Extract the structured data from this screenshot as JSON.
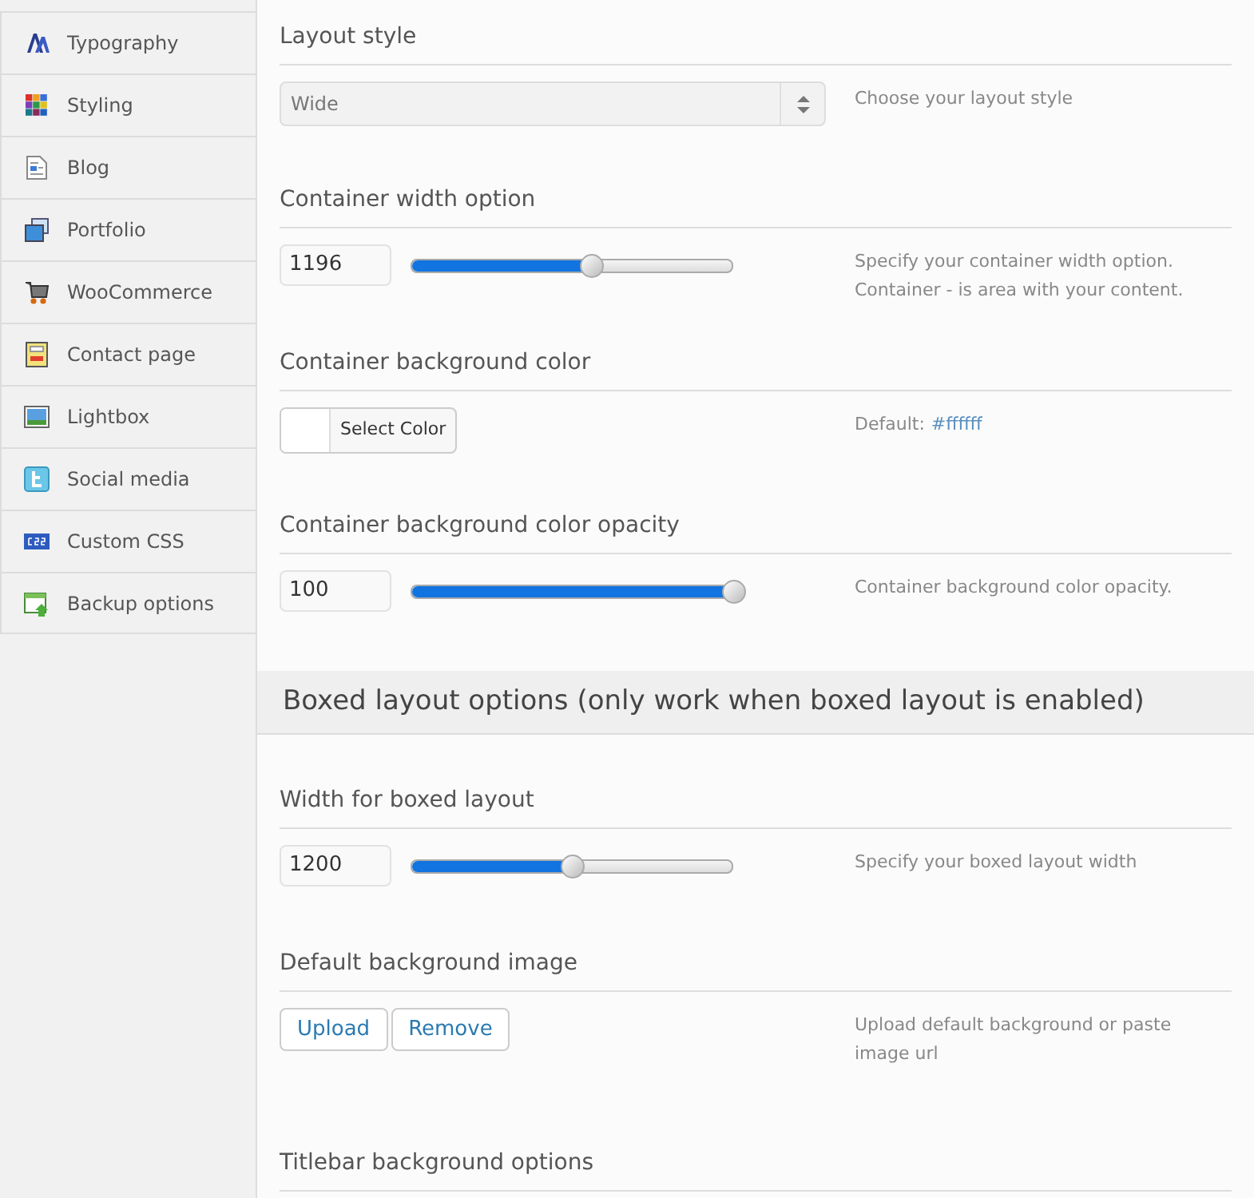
{
  "sidebar": {
    "items": [
      {
        "label": "Typography"
      },
      {
        "label": "Styling"
      },
      {
        "label": "Blog"
      },
      {
        "label": "Portfolio"
      },
      {
        "label": "WooCommerce"
      },
      {
        "label": "Contact page"
      },
      {
        "label": "Lightbox"
      },
      {
        "label": "Social media"
      },
      {
        "label": "Custom CSS"
      },
      {
        "label": "Backup options"
      }
    ]
  },
  "sections": [
    {
      "kind": "select",
      "heading": "Layout style",
      "value": "Wide",
      "help": "Choose your layout style"
    },
    {
      "kind": "slider",
      "heading": "Container width option",
      "value": "1196",
      "level": 0.56,
      "help": [
        "Specify your container width option.",
        "Container - is area with your content."
      ]
    },
    {
      "kind": "color",
      "heading": "Container background color",
      "button": "Select Color",
      "help_prefix": "Default: ",
      "help_value": "#ffffff"
    },
    {
      "kind": "slider",
      "heading": "Container background color opacity",
      "value": "100",
      "level": 1,
      "help": [
        "Container background color opacity."
      ]
    },
    {
      "kind": "band",
      "heading": "Boxed layout options (only work when boxed layout is enabled)"
    },
    {
      "kind": "slider",
      "heading": "Width for boxed layout",
      "value": "1200",
      "level": 0.5,
      "help": [
        "Specify your boxed layout width"
      ]
    },
    {
      "kind": "upload",
      "heading": "Default background image",
      "buttons": [
        "Upload",
        "Remove"
      ],
      "help": [
        "Upload default background or paste image url"
      ]
    },
    {
      "kind": "heading",
      "heading": "Titlebar background options"
    }
  ]
}
